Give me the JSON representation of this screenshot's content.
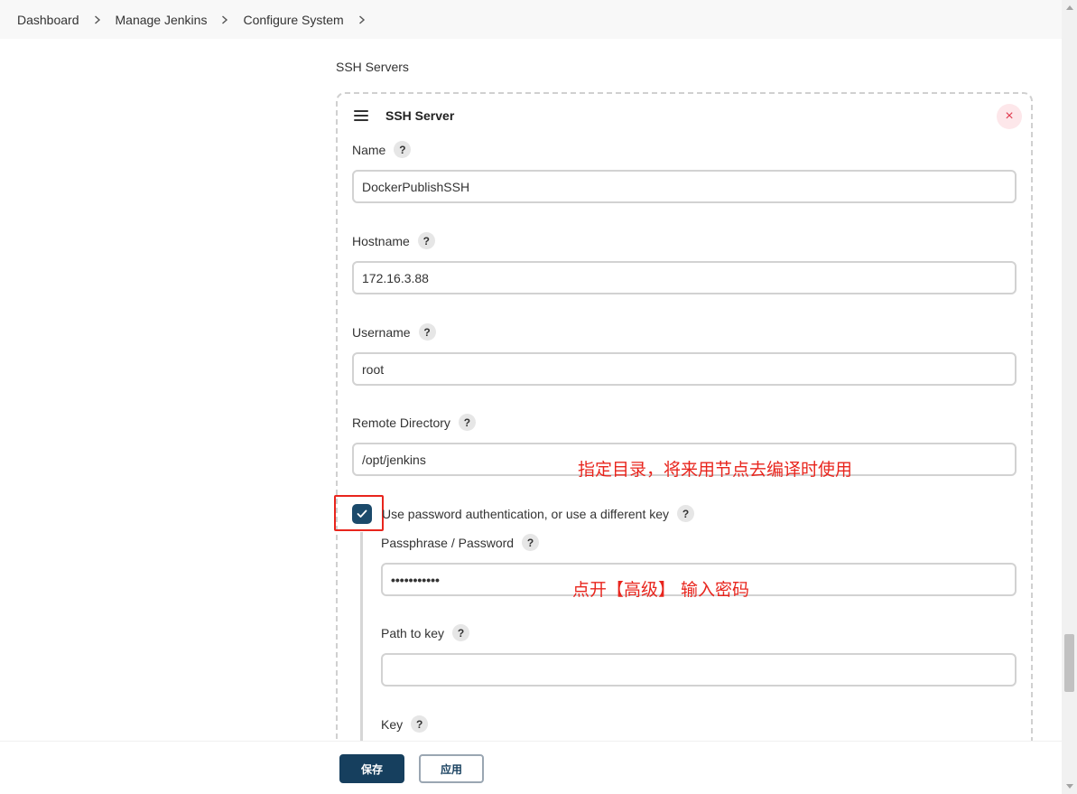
{
  "breadcrumb": {
    "items": [
      "Dashboard",
      "Manage Jenkins",
      "Configure System"
    ]
  },
  "section": {
    "title": "SSH Servers"
  },
  "server": {
    "title": "SSH Server",
    "close_symbol": "×",
    "fields": {
      "name": {
        "label": "Name",
        "value": "DockerPublishSSH"
      },
      "hostname": {
        "label": "Hostname",
        "value": "172.16.3.88"
      },
      "username": {
        "label": "Username",
        "value": "root"
      },
      "remote_directory": {
        "label": "Remote Directory",
        "value": "/opt/jenkins"
      }
    },
    "password_auth": {
      "label": "Use password authentication, or use a different key",
      "checked": true
    },
    "passphrase": {
      "label": "Passphrase / Password",
      "value": "•••••••••••"
    },
    "path_to_key": {
      "label": "Path to key",
      "value": ""
    },
    "key": {
      "label": "Key"
    }
  },
  "help_symbol": "?",
  "annotations": {
    "remote_dir_note": "指定目录，将来用节点去编译时使用",
    "password_note": "点开【高级】 输入密码"
  },
  "footer": {
    "save_label": "保存",
    "apply_label": "应用"
  },
  "colors": {
    "primary": "#163f5e",
    "checkbox": "#1b4a6b",
    "annotation": "#e8251d",
    "close": "#e03a4e"
  }
}
